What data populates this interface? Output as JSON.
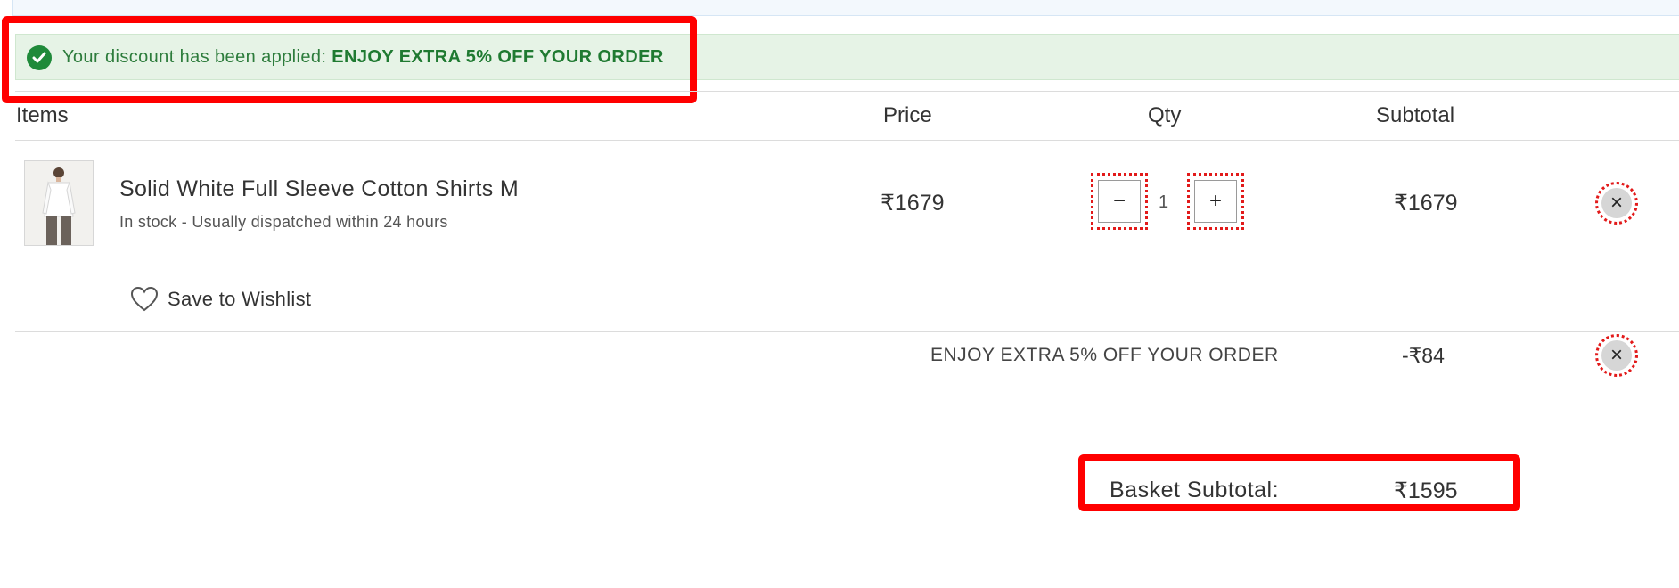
{
  "alert": {
    "prefix": "Your discount has been applied: ",
    "code": "ENJOY EXTRA 5% OFF YOUR ORDER",
    "icon": "check-circle-icon",
    "color": "#2d7c3c"
  },
  "table": {
    "headers": {
      "items": "Items",
      "price": "Price",
      "qty": "Qty",
      "subtotal": "Subtotal"
    }
  },
  "item": {
    "name": "Solid White Full Sleeve Cotton Shirts M",
    "stock": "In stock - Usually dispatched within 24 hours",
    "price": "₹1679",
    "qty": "1",
    "decrement": "−",
    "increment": "+",
    "subtotal": "₹1679",
    "remove": "×",
    "wishlist_label": "Save to Wishlist",
    "wishlist_icon": "heart-icon"
  },
  "discount": {
    "label": "ENJOY EXTRA 5% OFF YOUR ORDER",
    "amount": "-₹84",
    "remove": "×"
  },
  "basket": {
    "label": "Basket Subtotal:",
    "total": "₹1595"
  },
  "colors": {
    "alert_bg": "#e6f3e6",
    "success": "#1f8a3a",
    "annotation": "#ff0000"
  }
}
